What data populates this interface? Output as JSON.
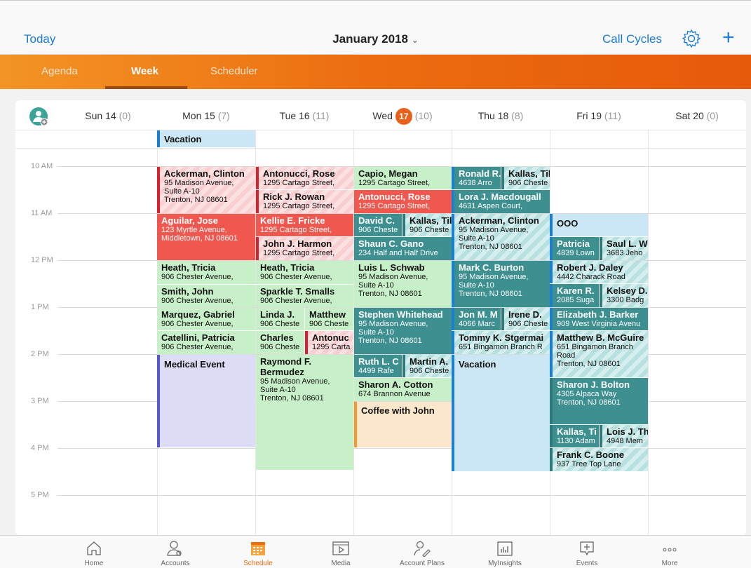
{
  "header": {
    "today": "Today",
    "month": "January 2018",
    "chevron": "⌄",
    "call_cycles": "Call Cycles",
    "settings_icon": "gear-icon",
    "add_icon": "plus-icon",
    "plus": "+"
  },
  "tabs": [
    {
      "label": "Agenda"
    },
    {
      "label": "Week"
    },
    {
      "label": "Scheduler"
    }
  ],
  "days": [
    {
      "label": "Sun 14",
      "count": "(0)"
    },
    {
      "label": "Mon 15",
      "count": "(7)"
    },
    {
      "label": "Tue 16",
      "count": "(11)"
    },
    {
      "label": "Wed",
      "badge": "17",
      "count": "(10)"
    },
    {
      "label": "Thu 18",
      "count": "(8)"
    },
    {
      "label": "Fri 19",
      "count": "(11)"
    },
    {
      "label": "Sat 20",
      "count": "(0)"
    }
  ],
  "times": [
    "10 AM",
    "11 AM",
    "12 PM",
    "1 PM",
    "2 PM",
    "3 PM",
    "4 PM",
    "5 PM"
  ],
  "allday": {
    "vacation": "Vacation"
  },
  "events": [
    {
      "t": "Ackerman, Clinton",
      "s": "95 Madison Avenue,\nSuite A-10\nTrenton, NJ 08601"
    },
    {
      "t": "Aguilar, Jose",
      "s": "123 Myrtle Avenue,\nMiddletown, NJ 08601"
    },
    {
      "t": "Heath, Tricia",
      "s": "906 Chester Avenue,"
    },
    {
      "t": "Smith, John",
      "s": "906 Chester Avenue,"
    },
    {
      "t": "Marquez, Gabriel",
      "s": "906 Chester Avenue,"
    },
    {
      "t": "Catellini, Patricia",
      "s": "906 Chester Avenue,"
    },
    {
      "t": "Medical Event",
      "s": ""
    },
    {
      "t": "Antonucci, Rose",
      "s": "1295 Cartago Street,"
    },
    {
      "t": "Rick J. Rowan",
      "s": "1295 Cartago Street,"
    },
    {
      "t": "Kellie E. Fricke",
      "s": "1295 Cartago Street,"
    },
    {
      "t": "John J. Harmon",
      "s": "1295 Cartago Street,"
    },
    {
      "t": "Heath, Tricia",
      "s": "906 Chester Avenue,"
    },
    {
      "t": "Sparkle T. Smalls",
      "s": "906 Chester Avenue,"
    },
    {
      "t": "Linda J.",
      "s": "906 Cheste"
    },
    {
      "t": "Matthew",
      "s": "906 Cheste"
    },
    {
      "t": "Charles",
      "s": "906 Cheste"
    },
    {
      "t": "Antonuc",
      "s": "1295 Carta"
    },
    {
      "t": "Raymond F.\nBermudez",
      "s": "95 Madison Avenue,\nSuite A-10\nTrenton, NJ 08601"
    },
    {
      "t": "Capio, Megan",
      "s": "1295 Cartago Street,"
    },
    {
      "t": "Antonucci, Rose",
      "s": "1295 Cartago Street,"
    },
    {
      "t": "David C.",
      "s": "906 Cheste"
    },
    {
      "t": "Kallas, Til",
      "s": "906 Cheste"
    },
    {
      "t": "Shaun C. Gano",
      "s": "234 Half and Half Drive"
    },
    {
      "t": "Luis L. Schwab",
      "s": "95 Madison Avenue,\nSuite A-10\nTrenton, NJ 08601"
    },
    {
      "t": "Stephen Whitehead",
      "s": "95 Madison Avenue,\nSuite A-10\nTrenton, NJ 08601"
    },
    {
      "t": "Ruth L. C",
      "s": "4499 Rafe"
    },
    {
      "t": "Martin A.",
      "s": "906 Cheste"
    },
    {
      "t": "Sharon A. Cotton",
      "s": "674 Brannon Avenue"
    },
    {
      "t": "Coffee with John",
      "s": ""
    },
    {
      "t": "Ronald R.",
      "s": "4638 Arro"
    },
    {
      "t": "Kallas, Til",
      "s": "906 Cheste"
    },
    {
      "t": "Lora J. Macdougall",
      "s": "4631 Aspen Court,"
    },
    {
      "t": "Ackerman, Clinton",
      "s": "95 Madison Avenue,\nSuite A-10\nTrenton, NJ 08601"
    },
    {
      "t": "Mark C. Burton",
      "s": "95 Madison Avenue,\nSuite A-10\nTrenton, NJ 08601"
    },
    {
      "t": "Jon M. M",
      "s": "4066 Marc"
    },
    {
      "t": "Irene D.",
      "s": "906 Cheste"
    },
    {
      "t": "Tommy K. Stgermai",
      "s": "651 Bingamon Branch R"
    },
    {
      "t": "Vacation",
      "s": ""
    },
    {
      "t": "OOO",
      "s": ""
    },
    {
      "t": "Patricia",
      "s": "4839 Lown"
    },
    {
      "t": "Saul L. W",
      "s": "3683 Jeho"
    },
    {
      "t": "Robert J. Daley",
      "s": "4442 Charack Road"
    },
    {
      "t": "Karen R.",
      "s": "2085 Suga"
    },
    {
      "t": "Kelsey D.",
      "s": "3300 Badg"
    },
    {
      "t": "Elizabeth J. Barker",
      "s": "909 West Virginia Avenu"
    },
    {
      "t": "Matthew B. McGuire",
      "s": "651 Bingamon Branch\nRoad\nTrenton, NJ 08601"
    },
    {
      "t": "Sharon J. Bolton",
      "s": "4305 Alpaca Way\nTrenton, NJ 08601"
    },
    {
      "t": "Kallas, Ti",
      "s": "1130 Adam"
    },
    {
      "t": "Lois J. Th",
      "s": "4948 Mem"
    },
    {
      "t": "Frank C. Boone",
      "s": "937 Tree Top Lane"
    }
  ],
  "bottom_nav": [
    {
      "label": "Home",
      "icon": "home-icon"
    },
    {
      "label": "Accounts",
      "icon": "accounts-icon"
    },
    {
      "label": "Schedule",
      "icon": "calendar-icon"
    },
    {
      "label": "Media",
      "icon": "media-icon"
    },
    {
      "label": "Account Plans",
      "icon": "account-plans-icon"
    },
    {
      "label": "MyInsights",
      "icon": "chart-icon"
    },
    {
      "label": "Events",
      "icon": "events-icon"
    },
    {
      "label": "More",
      "icon": "more-icon"
    }
  ],
  "colors": {
    "accent": "#1a7bd6",
    "brand": "#ec6c10"
  }
}
